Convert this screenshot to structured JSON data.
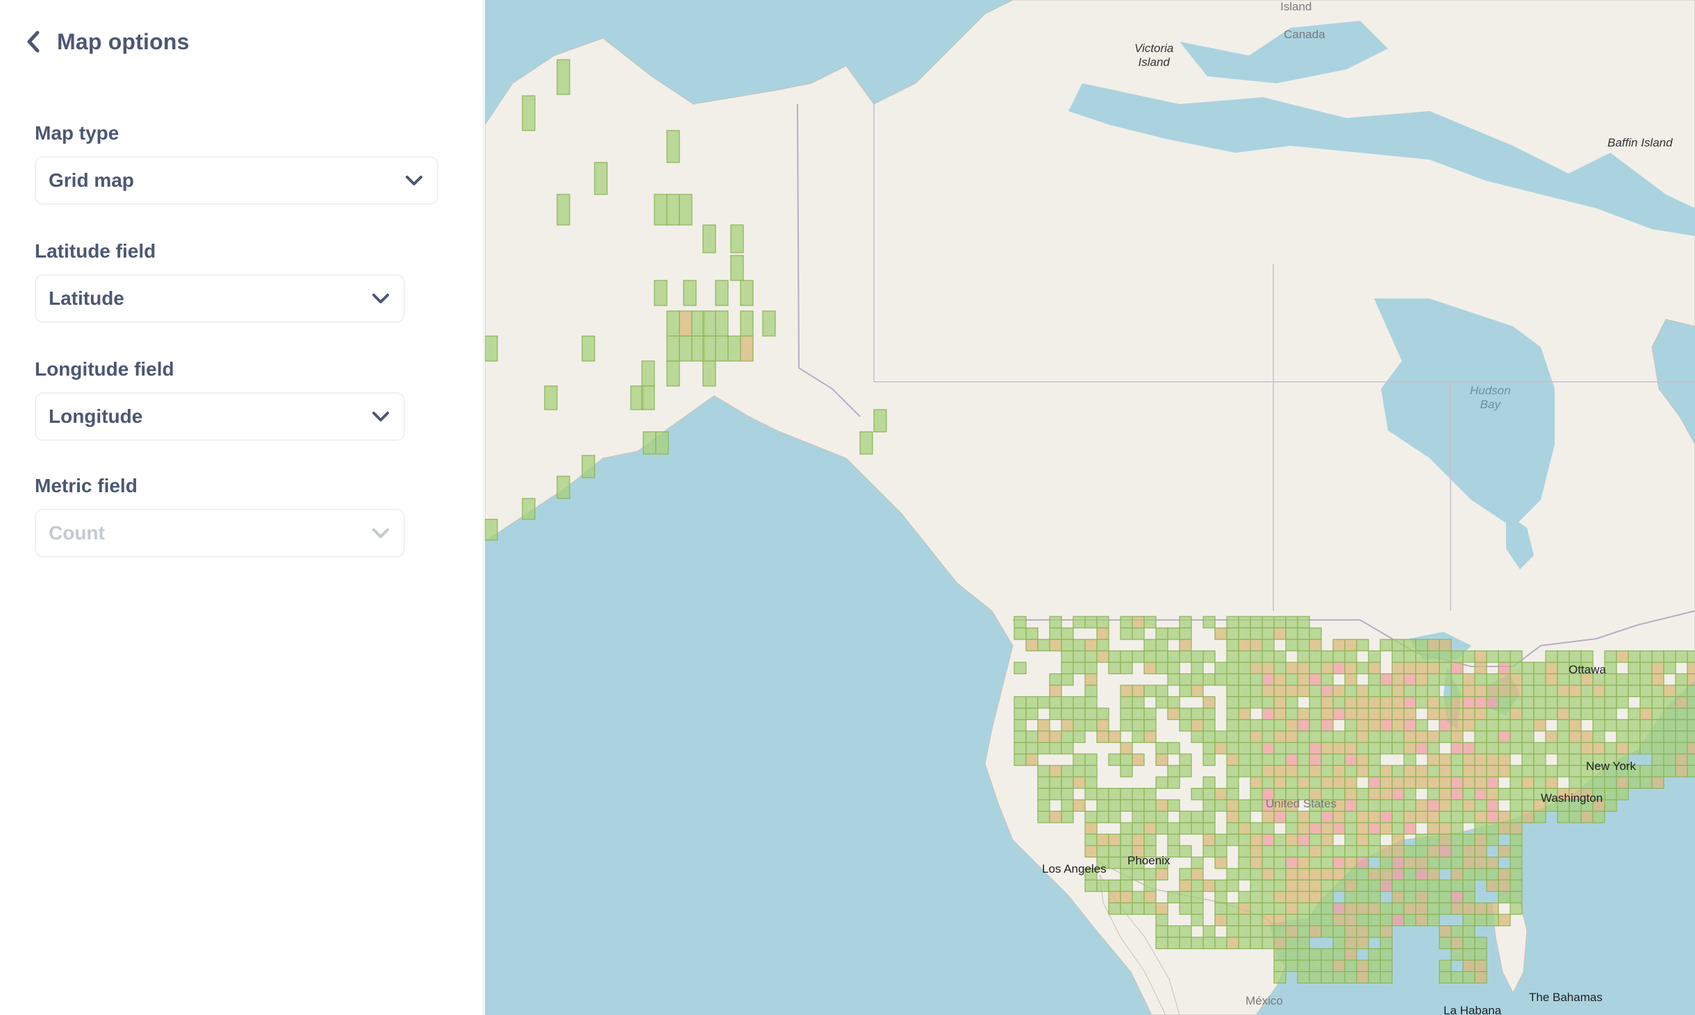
{
  "sidebar": {
    "title": "Map options",
    "fields": [
      {
        "label": "Map type",
        "value": "Grid map",
        "disabled": false
      },
      {
        "label": "Latitude field",
        "value": "Latitude",
        "disabled": false
      },
      {
        "label": "Longitude field",
        "value": "Longitude",
        "disabled": false
      },
      {
        "label": "Metric field",
        "value": "Count",
        "disabled": true
      }
    ]
  },
  "map": {
    "labels": {
      "island_top": "Island",
      "canada": "Canada",
      "victoria_island": "Victoria\nIsland",
      "baffin_island": "Baffin Island",
      "hudson_bay": "Hudson\nBay",
      "ottawa": "Ottawa",
      "new_york": "New York",
      "washington": "Washington",
      "united_states": "United States",
      "los_angeles": "Los Angeles",
      "phoenix": "Phoenix",
      "mexico": "México",
      "the_bahamas": "The Bahamas",
      "la_habana": "La Habana"
    },
    "colors": {
      "water": "#aad3df",
      "land": "#f2efe9",
      "cell_low": "#a7d07b",
      "cell_mid": "#d9b979",
      "cell_high": "#f0a0a0",
      "cell_stroke": "#8cb35a"
    }
  }
}
